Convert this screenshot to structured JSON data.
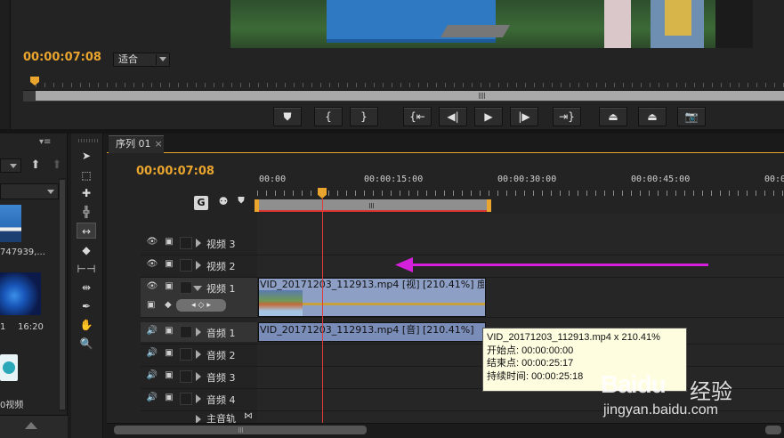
{
  "program_monitor": {
    "timecode": "00:00:07:08",
    "fit_select": "适合",
    "transport_buttons": [
      {
        "name": "add-marker-icon",
        "glyph": "⛊"
      },
      {
        "name": "mark-in-icon",
        "glyph": "{"
      },
      {
        "name": "mark-out-icon",
        "glyph": "}"
      },
      {
        "name": "go-to-in-icon",
        "glyph": "{⇤"
      },
      {
        "name": "step-back-icon",
        "glyph": "◀|"
      },
      {
        "name": "play-icon",
        "glyph": "▶"
      },
      {
        "name": "step-forward-icon",
        "glyph": "|▶"
      },
      {
        "name": "go-to-out-icon",
        "glyph": "⇥}"
      },
      {
        "name": "lift-icon",
        "glyph": "⏏"
      },
      {
        "name": "extract-icon",
        "glyph": "⏏"
      },
      {
        "name": "export-frame-icon",
        "glyph": "📷"
      }
    ]
  },
  "project_panel": {
    "item1_label": "747939,...",
    "item2_label_a": "1",
    "item2_label_b": "16:20",
    "item3_label": "0视频"
  },
  "tools": [
    "selection-tool-icon",
    "track-select-tool-icon",
    "ripple-edit-tool-icon",
    "rolling-edit-tool-icon",
    "rate-stretch-tool-icon",
    "razor-tool-icon",
    "slip-tool-icon",
    "slide-tool-icon",
    "pen-tool-icon",
    "hand-tool-icon",
    "zoom-tool-icon"
  ],
  "timeline": {
    "tab_label": "序列 01",
    "tab_close": "×",
    "timecode": "00:00:07:08",
    "ruler_labels": [
      "00:00",
      "00:00:15:00",
      "00:00:30:00",
      "00:00:45:00",
      "00:0"
    ],
    "tracks": {
      "v3": "视频 3",
      "v2": "视频 2",
      "v1": "视频 1",
      "a1": "音频 1",
      "a2": "音频 2",
      "a3": "音频 3",
      "a4": "音频 4",
      "master": "主音轨"
    },
    "video_clip_title": "VID_20171203_112913.mp4  [视] [210.41%] 度 ▾",
    "audio_clip_title": "VID_20171203_112913.mp4  [音] [210.41%]",
    "tooltip": {
      "line1": "VID_20171203_112913.mp4 x 210.41%",
      "line2": "开始点: 00:00:00:00",
      "line3": "结束点: 00:00:25:17",
      "line4": "持续时间: 00:00:25:18"
    }
  },
  "watermark": {
    "logo": "Baidu",
    "logo2": "经验",
    "url": "jingyan.baidu.com"
  },
  "colors": {
    "accent": "#e9a52d",
    "playhead": "#e23a3a",
    "annotation_arrow": "#d420d8",
    "video_clip": "#8e9fc6",
    "audio_clip": "#7a8cb8"
  }
}
